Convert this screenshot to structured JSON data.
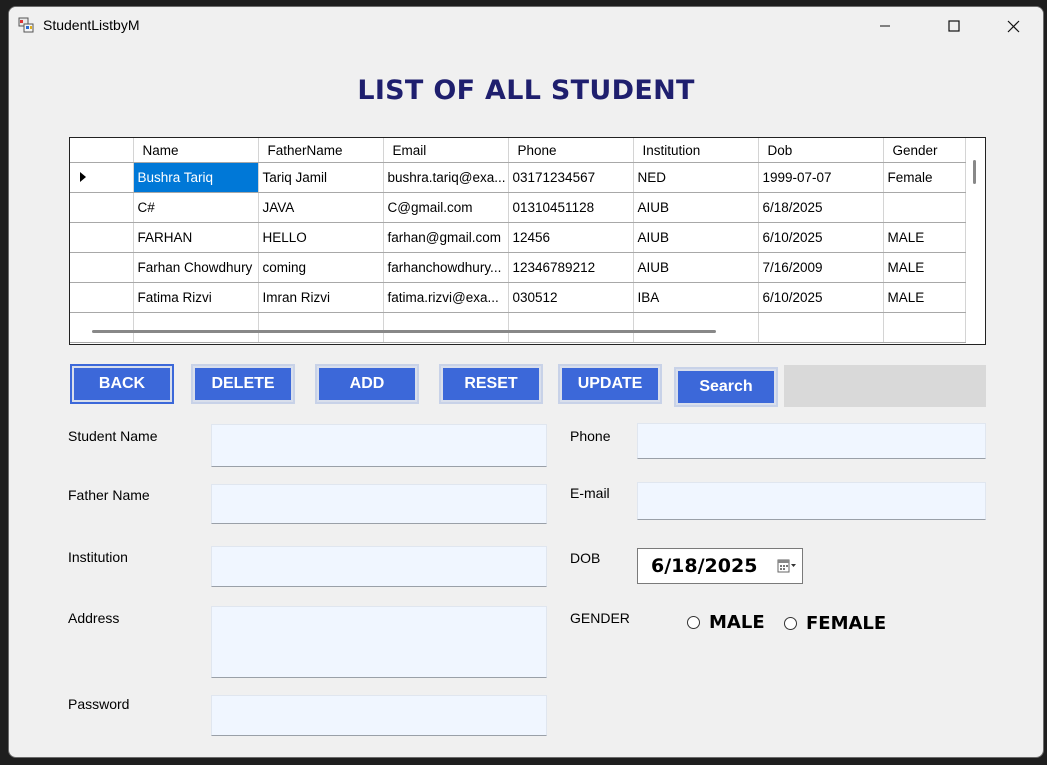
{
  "window": {
    "title": "StudentListbyM"
  },
  "heading": "LIST OF ALL STUDENT",
  "grid": {
    "columns": [
      "Name",
      "FatherName",
      "Email",
      "Phone",
      "Institution",
      "Dob",
      "Gender"
    ],
    "rows": [
      [
        "Bushra Tariq",
        "Tariq Jamil",
        "bushra.tariq@exa...",
        "03171234567",
        "NED",
        "1999-07-07",
        "Female"
      ],
      [
        "C#",
        "JAVA",
        "C@gmail.com",
        "01310451128",
        "AIUB",
        "6/18/2025",
        ""
      ],
      [
        "FARHAN",
        "HELLO",
        "farhan@gmail.com",
        "12456",
        "AIUB",
        "6/10/2025",
        "MALE"
      ],
      [
        "Farhan Chowdhury",
        "coming",
        "farhanchowdhury...",
        "12346789212",
        "AIUB",
        "7/16/2009",
        "MALE"
      ],
      [
        "Fatima Rizvi",
        "Imran Rizvi",
        "fatima.rizvi@exa...",
        "030512",
        "IBA",
        "6/10/2025",
        "MALE"
      ]
    ]
  },
  "buttons": {
    "back": "BACK",
    "delete": "DELETE",
    "add": "ADD",
    "reset": "RESET",
    "update": "UPDATE",
    "search": "Search"
  },
  "search_value": "",
  "form": {
    "student_name_label": "Student Name",
    "father_name_label": "Father Name",
    "institution_label": "Institution",
    "address_label": "Address",
    "password_label": "Password",
    "phone_label": "Phone",
    "email_label": "E-mail",
    "dob_label": "DOB",
    "dob_value": "6/18/2025",
    "gender_label": "GENDER",
    "male_label": "MALE",
    "female_label": "FEMALE"
  },
  "colors": {
    "button": "#3c68d9",
    "heading": "#1f1f6e",
    "selection": "#0078d7",
    "field": "#f0f6ff"
  }
}
